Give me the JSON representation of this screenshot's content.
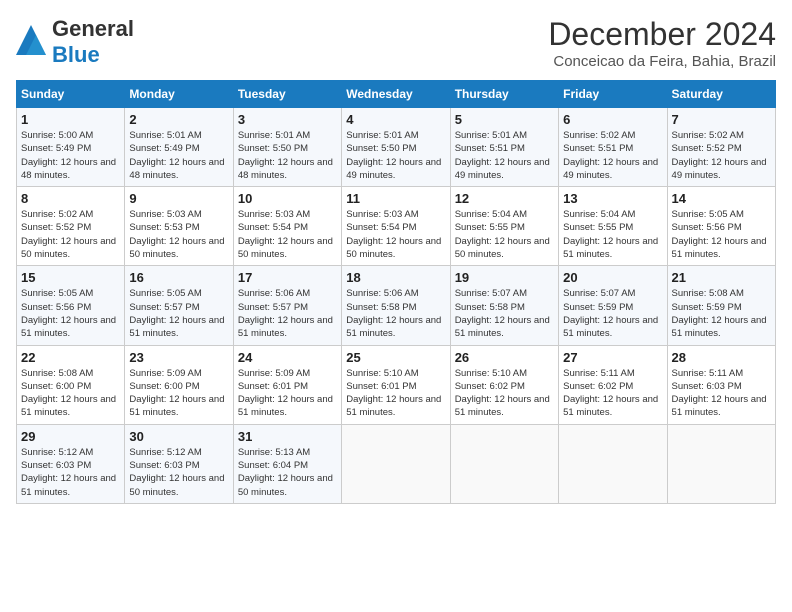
{
  "header": {
    "logo_general": "General",
    "logo_blue": "Blue",
    "month_title": "December 2024",
    "location": "Conceicao da Feira, Bahia, Brazil"
  },
  "weekdays": [
    "Sunday",
    "Monday",
    "Tuesday",
    "Wednesday",
    "Thursday",
    "Friday",
    "Saturday"
  ],
  "weeks": [
    [
      {
        "day": "1",
        "sunrise": "5:00 AM",
        "sunset": "5:49 PM",
        "daylight": "12 hours and 48 minutes."
      },
      {
        "day": "2",
        "sunrise": "5:01 AM",
        "sunset": "5:49 PM",
        "daylight": "12 hours and 48 minutes."
      },
      {
        "day": "3",
        "sunrise": "5:01 AM",
        "sunset": "5:50 PM",
        "daylight": "12 hours and 48 minutes."
      },
      {
        "day": "4",
        "sunrise": "5:01 AM",
        "sunset": "5:50 PM",
        "daylight": "12 hours and 49 minutes."
      },
      {
        "day": "5",
        "sunrise": "5:01 AM",
        "sunset": "5:51 PM",
        "daylight": "12 hours and 49 minutes."
      },
      {
        "day": "6",
        "sunrise": "5:02 AM",
        "sunset": "5:51 PM",
        "daylight": "12 hours and 49 minutes."
      },
      {
        "day": "7",
        "sunrise": "5:02 AM",
        "sunset": "5:52 PM",
        "daylight": "12 hours and 49 minutes."
      }
    ],
    [
      {
        "day": "8",
        "sunrise": "5:02 AM",
        "sunset": "5:52 PM",
        "daylight": "12 hours and 50 minutes."
      },
      {
        "day": "9",
        "sunrise": "5:03 AM",
        "sunset": "5:53 PM",
        "daylight": "12 hours and 50 minutes."
      },
      {
        "day": "10",
        "sunrise": "5:03 AM",
        "sunset": "5:54 PM",
        "daylight": "12 hours and 50 minutes."
      },
      {
        "day": "11",
        "sunrise": "5:03 AM",
        "sunset": "5:54 PM",
        "daylight": "12 hours and 50 minutes."
      },
      {
        "day": "12",
        "sunrise": "5:04 AM",
        "sunset": "5:55 PM",
        "daylight": "12 hours and 50 minutes."
      },
      {
        "day": "13",
        "sunrise": "5:04 AM",
        "sunset": "5:55 PM",
        "daylight": "12 hours and 51 minutes."
      },
      {
        "day": "14",
        "sunrise": "5:05 AM",
        "sunset": "5:56 PM",
        "daylight": "12 hours and 51 minutes."
      }
    ],
    [
      {
        "day": "15",
        "sunrise": "5:05 AM",
        "sunset": "5:56 PM",
        "daylight": "12 hours and 51 minutes."
      },
      {
        "day": "16",
        "sunrise": "5:05 AM",
        "sunset": "5:57 PM",
        "daylight": "12 hours and 51 minutes."
      },
      {
        "day": "17",
        "sunrise": "5:06 AM",
        "sunset": "5:57 PM",
        "daylight": "12 hours and 51 minutes."
      },
      {
        "day": "18",
        "sunrise": "5:06 AM",
        "sunset": "5:58 PM",
        "daylight": "12 hours and 51 minutes."
      },
      {
        "day": "19",
        "sunrise": "5:07 AM",
        "sunset": "5:58 PM",
        "daylight": "12 hours and 51 minutes."
      },
      {
        "day": "20",
        "sunrise": "5:07 AM",
        "sunset": "5:59 PM",
        "daylight": "12 hours and 51 minutes."
      },
      {
        "day": "21",
        "sunrise": "5:08 AM",
        "sunset": "5:59 PM",
        "daylight": "12 hours and 51 minutes."
      }
    ],
    [
      {
        "day": "22",
        "sunrise": "5:08 AM",
        "sunset": "6:00 PM",
        "daylight": "12 hours and 51 minutes."
      },
      {
        "day": "23",
        "sunrise": "5:09 AM",
        "sunset": "6:00 PM",
        "daylight": "12 hours and 51 minutes."
      },
      {
        "day": "24",
        "sunrise": "5:09 AM",
        "sunset": "6:01 PM",
        "daylight": "12 hours and 51 minutes."
      },
      {
        "day": "25",
        "sunrise": "5:10 AM",
        "sunset": "6:01 PM",
        "daylight": "12 hours and 51 minutes."
      },
      {
        "day": "26",
        "sunrise": "5:10 AM",
        "sunset": "6:02 PM",
        "daylight": "12 hours and 51 minutes."
      },
      {
        "day": "27",
        "sunrise": "5:11 AM",
        "sunset": "6:02 PM",
        "daylight": "12 hours and 51 minutes."
      },
      {
        "day": "28",
        "sunrise": "5:11 AM",
        "sunset": "6:03 PM",
        "daylight": "12 hours and 51 minutes."
      }
    ],
    [
      {
        "day": "29",
        "sunrise": "5:12 AM",
        "sunset": "6:03 PM",
        "daylight": "12 hours and 51 minutes."
      },
      {
        "day": "30",
        "sunrise": "5:12 AM",
        "sunset": "6:03 PM",
        "daylight": "12 hours and 50 minutes."
      },
      {
        "day": "31",
        "sunrise": "5:13 AM",
        "sunset": "6:04 PM",
        "daylight": "12 hours and 50 minutes."
      },
      null,
      null,
      null,
      null
    ]
  ],
  "labels": {
    "sunrise": "Sunrise:",
    "sunset": "Sunset:",
    "daylight": "Daylight: 12 hours"
  }
}
